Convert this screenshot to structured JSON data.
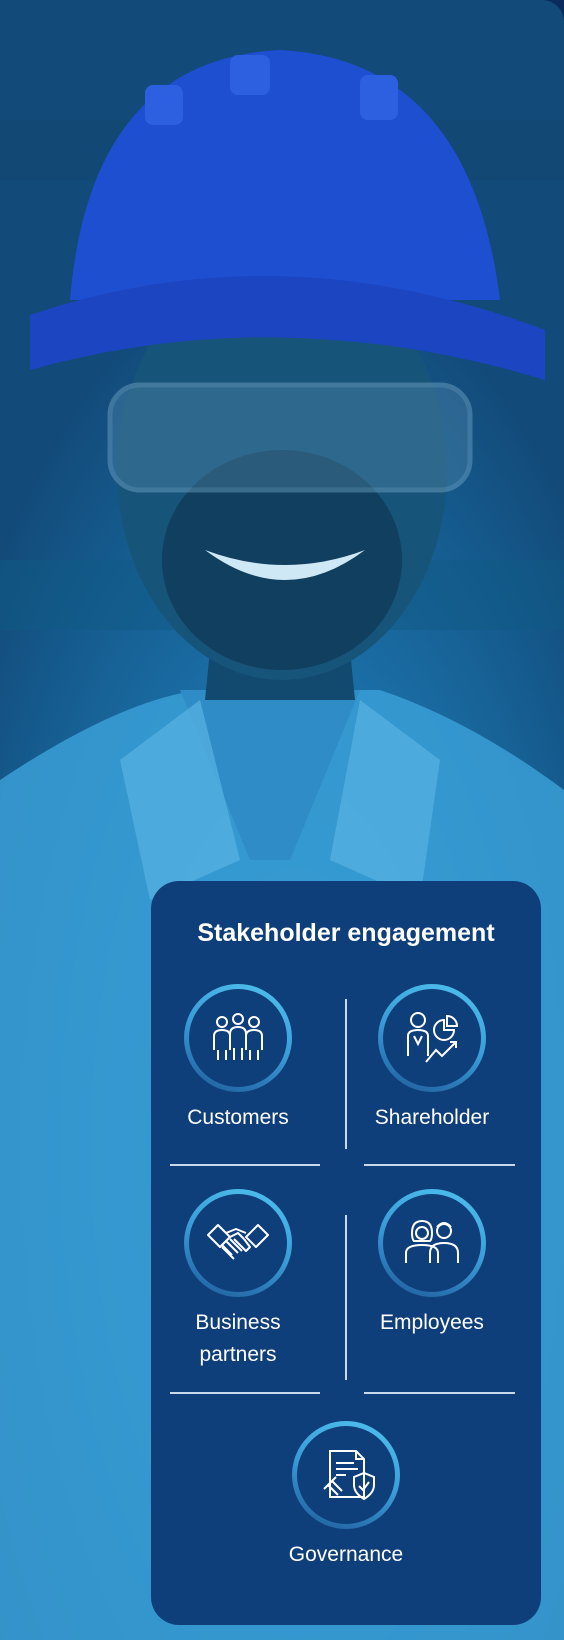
{
  "background": {
    "subject": "worker-photo",
    "tint": "#1a6fa7"
  },
  "panel": {
    "title": "Stakeholder engagement",
    "accent": "#4fc3ee",
    "background": "#0f3f7a",
    "items": [
      {
        "label": "Customers",
        "icon": "customers-icon"
      },
      {
        "label": "Shareholder",
        "icon": "shareholder-icon"
      },
      {
        "label": "Business partners",
        "icon": "handshake-icon"
      },
      {
        "label": "Employees",
        "icon": "employees-icon"
      },
      {
        "label": "Governance",
        "icon": "governance-icon"
      }
    ]
  }
}
